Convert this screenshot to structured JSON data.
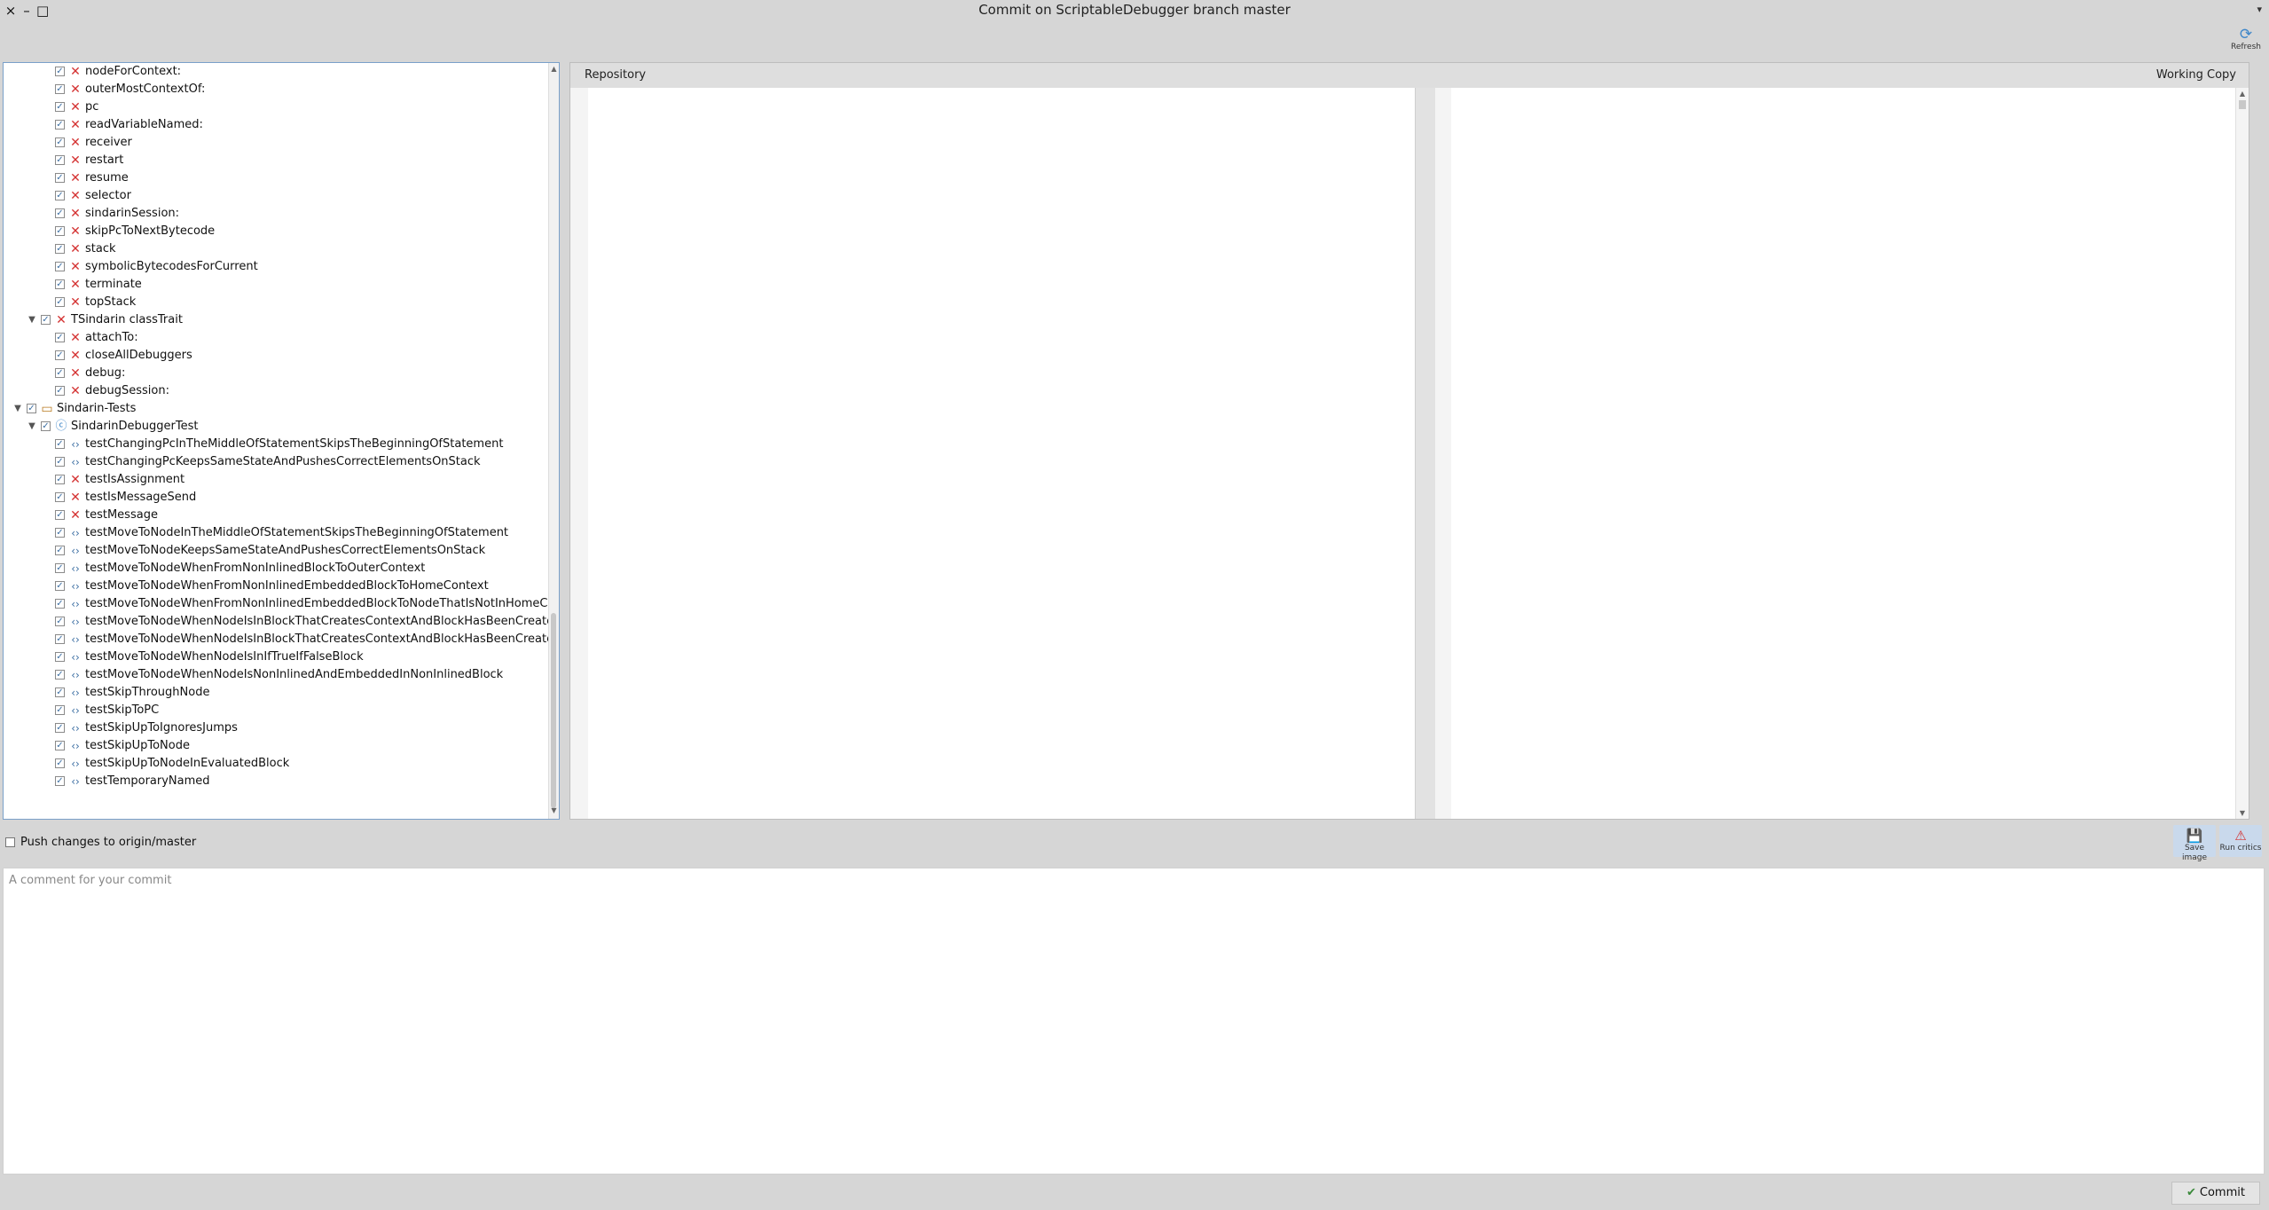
{
  "window": {
    "title": "Commit on ScriptableDebugger branch master",
    "close_glyph": "×",
    "minimize_glyph": "–",
    "maximize_glyph": "□",
    "menu_glyph": "▾"
  },
  "toolbar": {
    "refresh_label": "Refresh",
    "refresh_icon": "refresh-icon"
  },
  "tree": {
    "rows": [
      {
        "label": "nodeForContext:",
        "icon": "x",
        "level": 3,
        "expander": ""
      },
      {
        "label": "outerMostContextOf:",
        "icon": "x",
        "level": 3,
        "expander": ""
      },
      {
        "label": "pc",
        "icon": "x",
        "level": 3,
        "expander": ""
      },
      {
        "label": "readVariableNamed:",
        "icon": "x",
        "level": 3,
        "expander": ""
      },
      {
        "label": "receiver",
        "icon": "x",
        "level": 3,
        "expander": ""
      },
      {
        "label": "restart",
        "icon": "x",
        "level": 3,
        "expander": ""
      },
      {
        "label": "resume",
        "icon": "x",
        "level": 3,
        "expander": ""
      },
      {
        "label": "selector",
        "icon": "x",
        "level": 3,
        "expander": ""
      },
      {
        "label": "sindarinSession:",
        "icon": "x",
        "level": 3,
        "expander": ""
      },
      {
        "label": "skipPcToNextBytecode",
        "icon": "x",
        "level": 3,
        "expander": ""
      },
      {
        "label": "stack",
        "icon": "x",
        "level": 3,
        "expander": ""
      },
      {
        "label": "symbolicBytecodesForCurrent",
        "icon": "x",
        "level": 3,
        "expander": ""
      },
      {
        "label": "terminate",
        "icon": "x",
        "level": 3,
        "expander": ""
      },
      {
        "label": "topStack",
        "icon": "x",
        "level": 3,
        "expander": ""
      },
      {
        "label": "TSindarin classTrait",
        "icon": "x",
        "level": 2,
        "expander": "▼"
      },
      {
        "label": "attachTo:",
        "icon": "x",
        "level": 3,
        "expander": ""
      },
      {
        "label": "closeAllDebuggers",
        "icon": "x",
        "level": 3,
        "expander": ""
      },
      {
        "label": "debug:",
        "icon": "x",
        "level": 3,
        "expander": ""
      },
      {
        "label": "debugSession:",
        "icon": "x",
        "level": 3,
        "expander": ""
      },
      {
        "label": "Sindarin-Tests",
        "icon": "pkg",
        "level": 1,
        "expander": "▼"
      },
      {
        "label": "SindarinDebuggerTest",
        "icon": "cls",
        "level": 2,
        "expander": "▼"
      },
      {
        "label": "testChangingPcInTheMiddleOfStatementSkipsTheBeginningOfStatement",
        "icon": "code",
        "level": 3,
        "expander": ""
      },
      {
        "label": "testChangingPcKeepsSameStateAndPushesCorrectElementsOnStack",
        "icon": "code",
        "level": 3,
        "expander": ""
      },
      {
        "label": "testIsAssignment",
        "icon": "x",
        "level": 3,
        "expander": ""
      },
      {
        "label": "testIsMessageSend",
        "icon": "x",
        "level": 3,
        "expander": ""
      },
      {
        "label": "testMessage",
        "icon": "x",
        "level": 3,
        "expander": ""
      },
      {
        "label": "testMoveToNodeInTheMiddleOfStatementSkipsTheBeginningOfStatement",
        "icon": "code",
        "level": 3,
        "expander": ""
      },
      {
        "label": "testMoveToNodeKeepsSameStateAndPushesCorrectElementsOnStack",
        "icon": "code",
        "level": 3,
        "expander": ""
      },
      {
        "label": "testMoveToNodeWhenFromNonInlinedBlockToOuterContext",
        "icon": "code",
        "level": 3,
        "expander": ""
      },
      {
        "label": "testMoveToNodeWhenFromNonInlinedEmbeddedBlockToHomeContext",
        "icon": "code",
        "level": 3,
        "expander": ""
      },
      {
        "label": "testMoveToNodeWhenFromNonInlinedEmbeddedBlockToNodeThatIsNotInHomeContext",
        "icon": "code",
        "level": 3,
        "expander": ""
      },
      {
        "label": "testMoveToNodeWhenNodeIsInBlockThatCreatesContextAndBlockHasBeenCreated",
        "icon": "code",
        "level": 3,
        "expander": ""
      },
      {
        "label": "testMoveToNodeWhenNodeIsInBlockThatCreatesContextAndBlockHasBeenCreatedBackward",
        "icon": "code",
        "level": 3,
        "expander": ""
      },
      {
        "label": "testMoveToNodeWhenNodeIsInIfTrueIfFalseBlock",
        "icon": "code",
        "level": 3,
        "expander": ""
      },
      {
        "label": "testMoveToNodeWhenNodeIsNonInlinedAndEmbeddedInNonInlinedBlock",
        "icon": "code",
        "level": 3,
        "expander": ""
      },
      {
        "label": "testSkipThroughNode",
        "icon": "code",
        "level": 3,
        "expander": ""
      },
      {
        "label": "testSkipToPC",
        "icon": "code",
        "level": 3,
        "expander": ""
      },
      {
        "label": "testSkipUpToIgnoresJumps",
        "icon": "code",
        "level": 3,
        "expander": ""
      },
      {
        "label": "testSkipUpToNode",
        "icon": "code",
        "level": 3,
        "expander": ""
      },
      {
        "label": "testSkipUpToNodeInEvaluatedBlock",
        "icon": "code",
        "level": 3,
        "expander": ""
      },
      {
        "label": "testTemporaryNamed",
        "icon": "code",
        "level": 3,
        "expander": ""
      }
    ]
  },
  "diff": {
    "left_header": "Repository",
    "right_header": "Working Copy"
  },
  "push": {
    "label": "Push changes to origin/master",
    "checked": false
  },
  "actions": {
    "save_image_label": "Save image",
    "run_critics_label": "Run critics"
  },
  "comment": {
    "placeholder": "A comment for your commit"
  },
  "commit": {
    "label": "Commit"
  },
  "colors": {
    "remove": "#d43232",
    "accent": "#3f87c9",
    "commit_check": "#3b8a3b"
  }
}
